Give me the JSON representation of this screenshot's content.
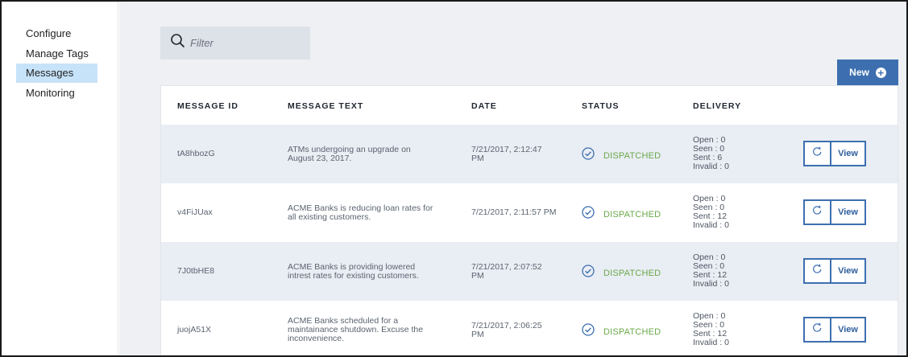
{
  "sidebar": {
    "items": [
      {
        "label": "Configure"
      },
      {
        "label": "Manage Tags"
      },
      {
        "label": "Messages"
      },
      {
        "label": "Monitoring"
      }
    ]
  },
  "filter": {
    "placeholder": "Filter"
  },
  "toolbar": {
    "new_label": "New"
  },
  "table": {
    "headers": [
      "MESSAGE ID",
      "MESSAGE TEXT",
      "DATE",
      "STATUS",
      "DELIVERY"
    ],
    "rows": [
      {
        "id": "tA8hbozG",
        "text_lines": [
          "ATMs undergoing an upgrade on",
          "August 23, 2017."
        ],
        "date_lines": [
          "7/21/2017, 2:12:47",
          "PM"
        ],
        "status": "DISPATCHED",
        "delivery": [
          "Open : 0",
          "Seen : 0",
          "Sent : 6",
          "Invalid : 0"
        ],
        "view_label": "View"
      },
      {
        "id": "v4FiJUax",
        "text_lines": [
          "ACME Banks is reducing loan rates for",
          "all existing customers."
        ],
        "date_lines": [
          "7/21/2017, 2:11:57 PM"
        ],
        "status": "DISPATCHED",
        "delivery": [
          "Open : 0",
          "Seen : 0",
          "Sent : 12",
          "Invalid : 0"
        ],
        "view_label": "View"
      },
      {
        "id": "7J0tbHE8",
        "text_lines": [
          "ACME Banks is providing lowered",
          "intrest rates for existing customers."
        ],
        "date_lines": [
          "7/21/2017, 2:07:52",
          "PM"
        ],
        "status": "DISPATCHED",
        "delivery": [
          "Open : 0",
          "Seen : 0",
          "Sent : 12",
          "Invalid : 0"
        ],
        "view_label": "View"
      },
      {
        "id": "juojA51X",
        "text_lines": [
          "ACME Banks scheduled for a",
          "maintainance shutdown. Excuse the",
          "inconvenience."
        ],
        "date_lines": [
          "7/21/2017, 2:06:25",
          "PM"
        ],
        "status": "DISPATCHED",
        "delivery": [
          "Open : 0",
          "Seen : 0",
          "Sent : 12",
          "Invalid : 0"
        ],
        "view_label": "View"
      }
    ]
  },
  "icons": {
    "filter": "search-icon",
    "new": "plus-circle-icon",
    "status": "check-circle-icon",
    "resend": "refresh-icon"
  },
  "colors": {
    "accent": "#3d6fb0",
    "active_nav": "#c7e3f9",
    "status_ok": "#6aa94a"
  }
}
